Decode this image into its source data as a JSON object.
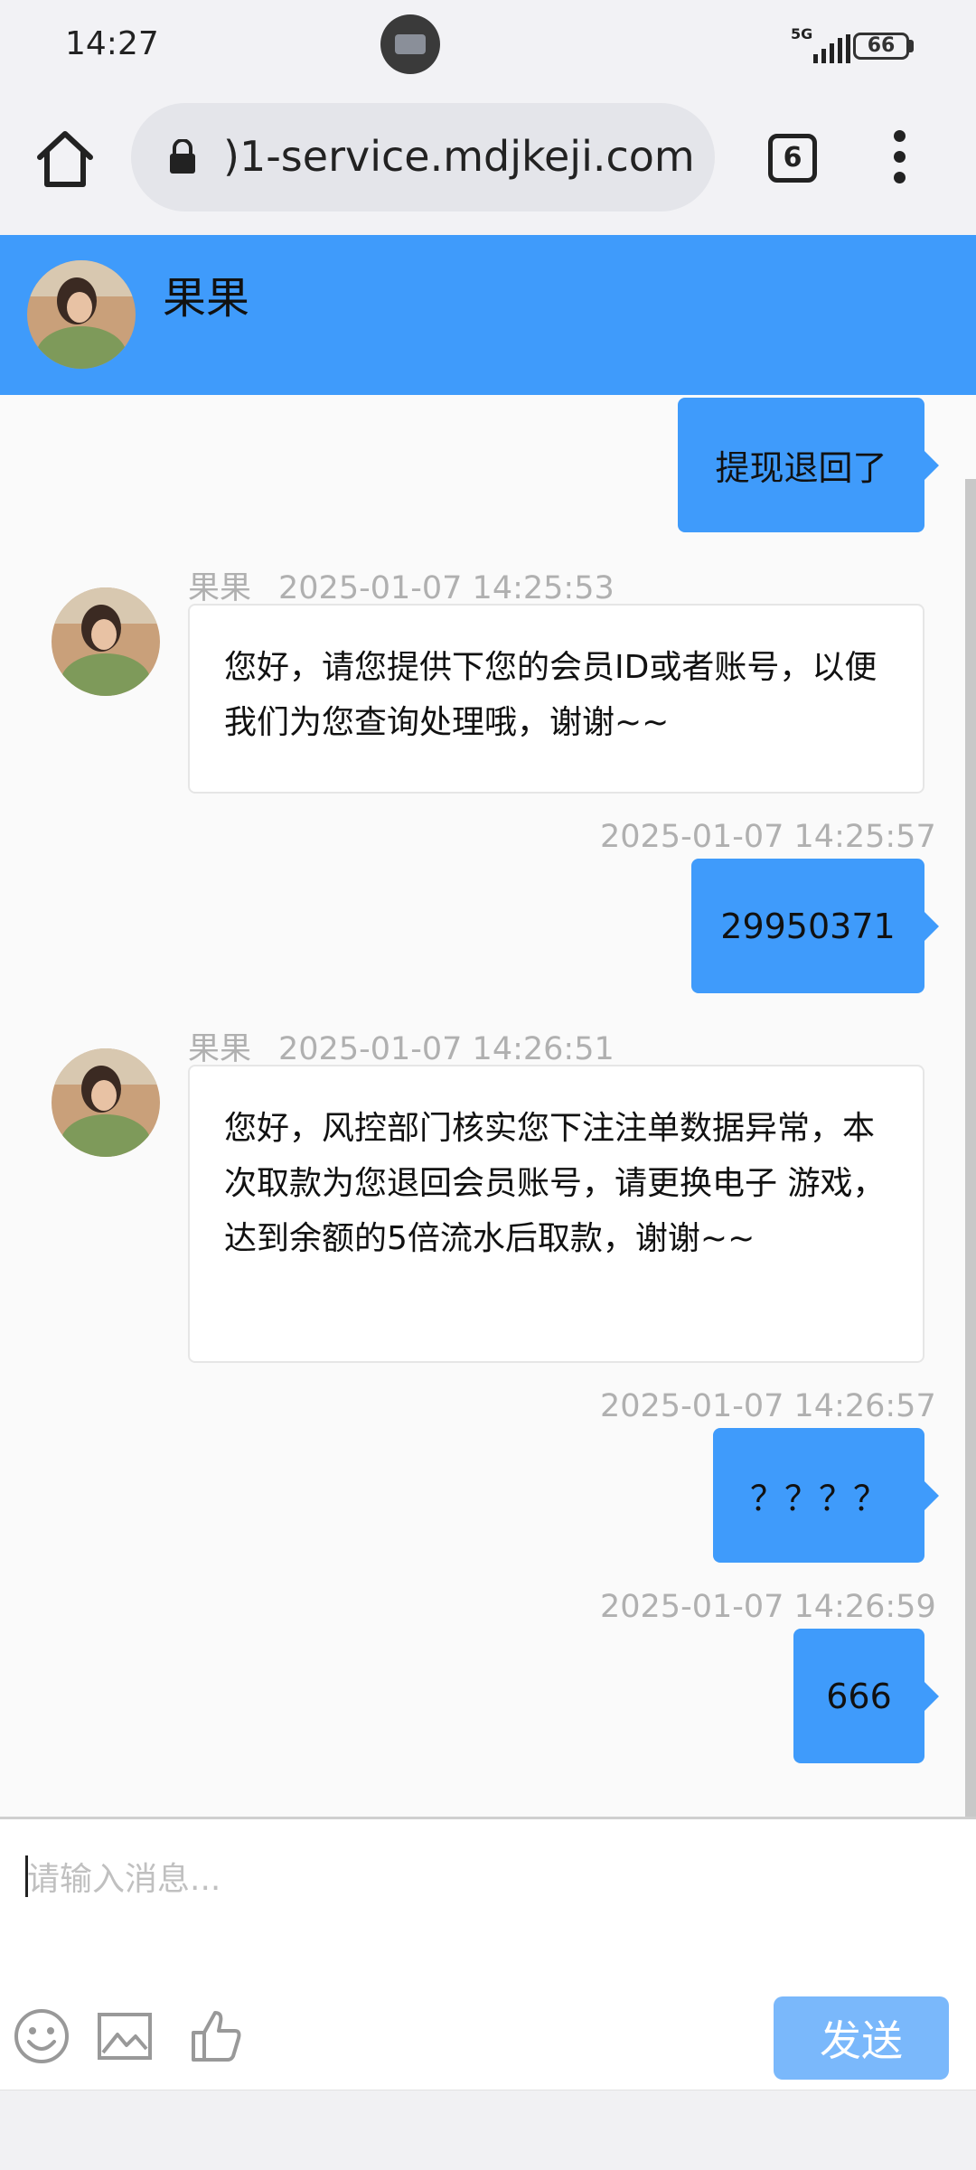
{
  "status_bar": {
    "time": "14:27",
    "network": "5G",
    "battery": "66"
  },
  "browser": {
    "url": ")1-service.mdjkeji.com",
    "tab_count": "6"
  },
  "chat": {
    "agent_name": "果果",
    "messages": [
      {
        "direction": "out",
        "time": "",
        "text": "提现退回了"
      },
      {
        "direction": "in",
        "sender": "果果",
        "time": "2025-01-07 14:25:53",
        "text": "您好，请您提供下您的会员ID或者账号，以便我们为您查询处理哦，谢谢~~"
      },
      {
        "direction": "out",
        "time": "2025-01-07 14:25:57",
        "text": "29950371"
      },
      {
        "direction": "in",
        "sender": "果果",
        "time": "2025-01-07 14:26:51",
        "text": "您好，风控部门核实您下注注单数据异常，本次取款为您退回会员账号，请更换电子 游戏，达到余额的5倍流水后取款，谢谢~~"
      },
      {
        "direction": "out",
        "time": "2025-01-07 14:26:57",
        "text": "？？？？"
      },
      {
        "direction": "out",
        "time": "2025-01-07 14:26:59",
        "text": "666"
      }
    ]
  },
  "composer": {
    "placeholder": "请输入消息...",
    "send_label": "发送",
    "tools": [
      "emoji-icon",
      "image-icon",
      "thumbs-up-icon"
    ]
  },
  "colors": {
    "accent": "#3f9bfb",
    "send_button": "#7ab8fb"
  }
}
